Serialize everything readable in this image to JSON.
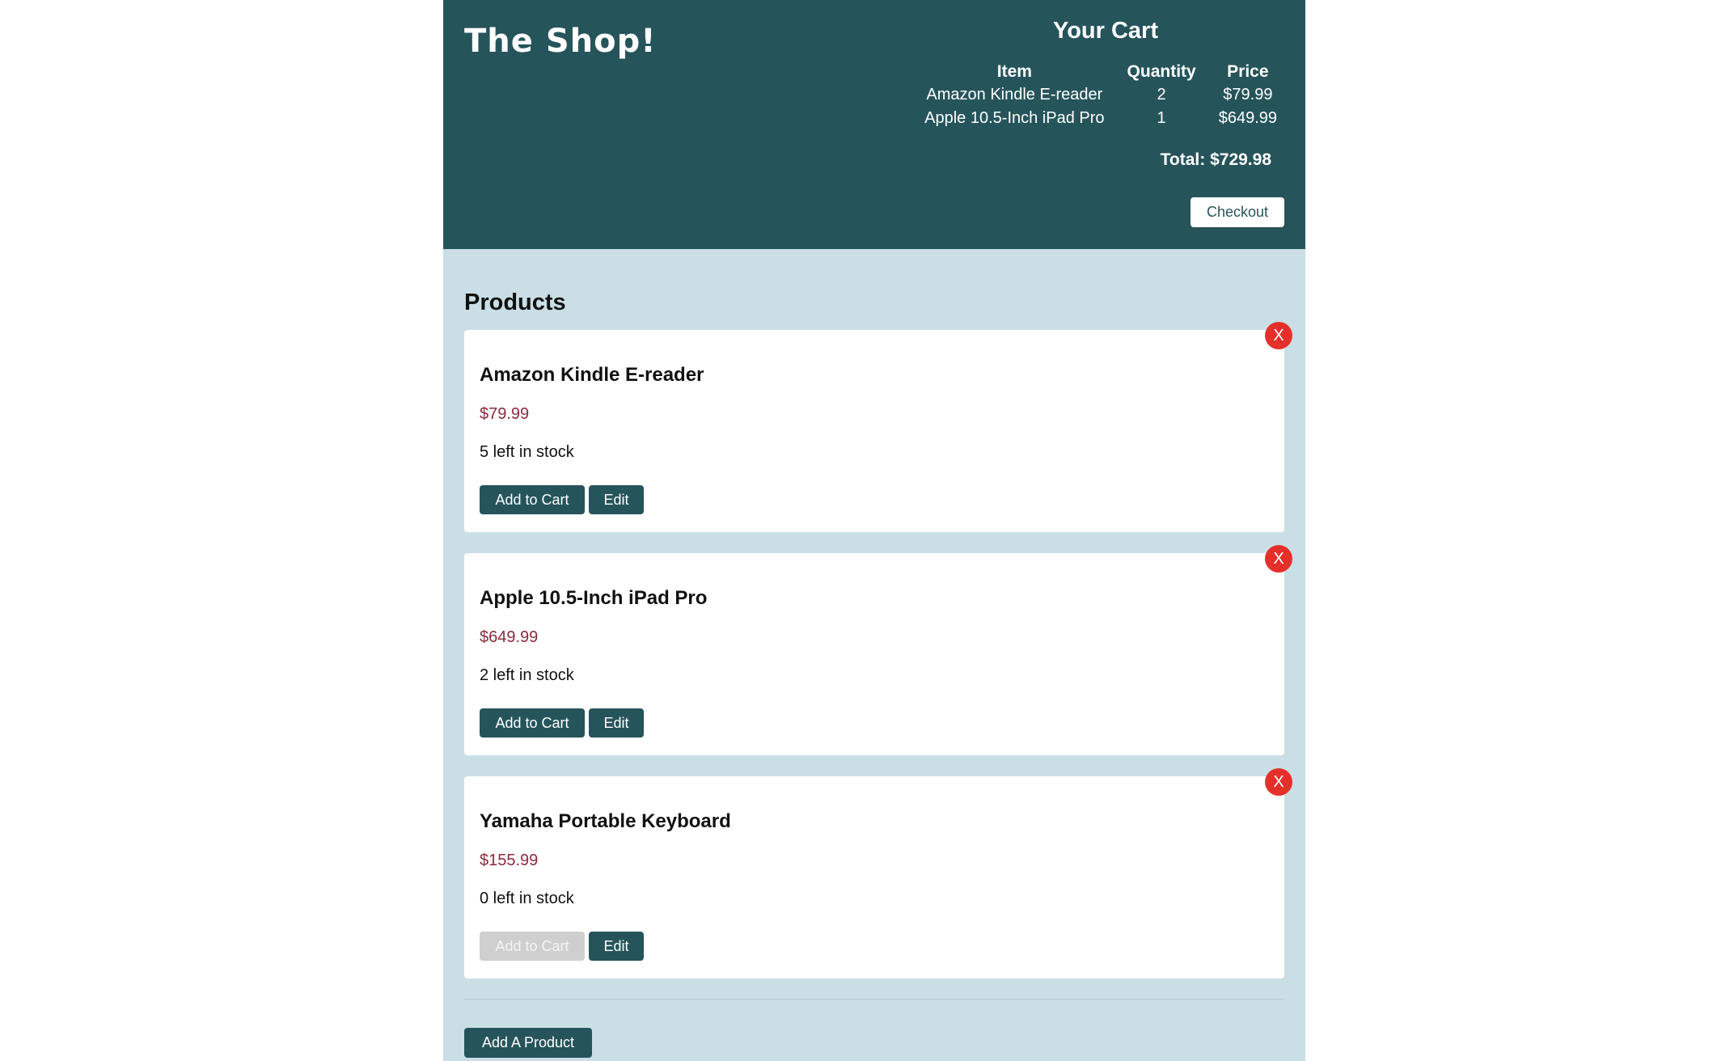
{
  "header": {
    "logo_text": "The Shop!"
  },
  "cart": {
    "title": "Your Cart",
    "columns": [
      "Item",
      "Quantity",
      "Price"
    ],
    "items": [
      {
        "item": "Amazon Kindle E-reader",
        "quantity": "2",
        "price": "$79.99"
      },
      {
        "item": "Apple 10.5-Inch iPad Pro",
        "quantity": "1",
        "price": "$649.99"
      }
    ],
    "total": "Total: $729.98",
    "checkout_label": "Checkout"
  },
  "products": {
    "heading": "Products",
    "items": [
      {
        "name": "Amazon Kindle E-reader",
        "price": "$79.99",
        "stock": "5 left in stock",
        "add_label": "Add to Cart",
        "edit_label": "Edit",
        "delete_label": "X",
        "add_disabled": false
      },
      {
        "name": "Apple 10.5-Inch iPad Pro",
        "price": "$649.99",
        "stock": "2 left in stock",
        "add_label": "Add to Cart",
        "edit_label": "Edit",
        "delete_label": "X",
        "add_disabled": false
      },
      {
        "name": "Yamaha Portable Keyboard",
        "price": "$155.99",
        "stock": "0 left in stock",
        "add_label": "Add to Cart",
        "edit_label": "Edit",
        "delete_label": "X",
        "add_disabled": true
      }
    ],
    "add_product_label": "Add A Product"
  },
  "colors": {
    "header_bg": "#26545b",
    "page_bg": "#cadfe5",
    "price_text": "#8b2a3c",
    "delete_button": "#e5302a",
    "disabled_button": "#cfcfcf"
  }
}
